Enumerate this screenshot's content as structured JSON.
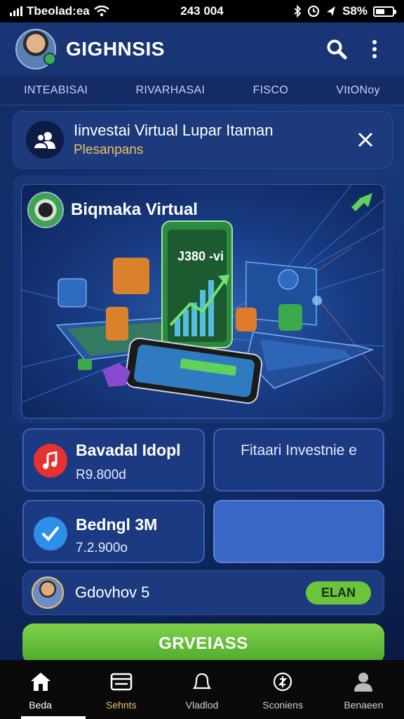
{
  "status_bar": {
    "carrier": "Tbeolad:ea",
    "time": "243 004",
    "battery": "S8%"
  },
  "header": {
    "title": "GIGHNSIS"
  },
  "tabs": [
    {
      "label": "INTEABISAI"
    },
    {
      "label": "RIVARHASAI"
    },
    {
      "label": "FISCO"
    },
    {
      "label": "VItONoy"
    }
  ],
  "notice": {
    "title": "Iinvestai Virtual Lupar Itaman",
    "subtitle": "Plesanpans"
  },
  "hero": {
    "title": "Biqmaka Virtual",
    "phone_value": "J380 -vi"
  },
  "cards": [
    {
      "title": "Bavadal Idopl",
      "value": "R9.800d",
      "icon": "music-icon",
      "icon_color": "#e5312f"
    },
    {
      "title": "Fitaari Investnie e",
      "value": ""
    },
    {
      "title": "Bedngl 3M",
      "value": "7.2.900o",
      "icon": "check-icon",
      "icon_color": "#2d8fe8"
    },
    {
      "title": "",
      "value": ""
    }
  ],
  "profile": {
    "name": "Gdovhov 5",
    "plan_label": "ELAN"
  },
  "cta": {
    "label": "GRVEIASS"
  },
  "bottom_nav": [
    {
      "label": "Beda",
      "icon": "home-icon"
    },
    {
      "label": "Sehnts",
      "icon": "card-icon"
    },
    {
      "label": "Vladlod",
      "icon": "bell-icon"
    },
    {
      "label": "Sconiens",
      "icon": "settings-icon"
    },
    {
      "label": "Benaeen",
      "icon": "profile-icon"
    }
  ],
  "colors": {
    "background": "#0f1f4e",
    "accent_green": "#6cc43a",
    "accent_gold": "#f0c060"
  }
}
